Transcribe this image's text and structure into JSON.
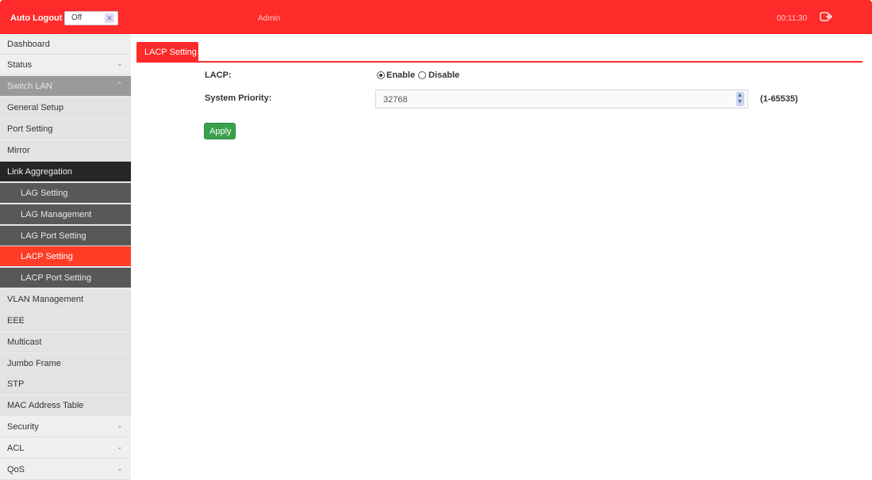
{
  "header": {
    "auto_logout_label": "Auto Logout :",
    "auto_logout_value": "Off",
    "user": "Admin",
    "time": "00:11:30",
    "logout_icon": "logout-icon"
  },
  "sidebar": {
    "items": [
      {
        "label": "Dashboard"
      },
      {
        "label": "Status"
      },
      {
        "label": "Switch LAN"
      },
      {
        "label": "General Setup"
      },
      {
        "label": "Port Setting"
      },
      {
        "label": "Mirror"
      },
      {
        "label": "Link Aggregation"
      },
      {
        "label": "LAG Setting"
      },
      {
        "label": "LAG Management"
      },
      {
        "label": "LAG Port Setting"
      },
      {
        "label": "LACP Setting"
      },
      {
        "label": "LACP Port Setting"
      },
      {
        "label": "VLAN Management"
      },
      {
        "label": "EEE"
      },
      {
        "label": "Multicast"
      },
      {
        "label": "Jumbo Frame"
      },
      {
        "label": "STP"
      },
      {
        "label": "MAC Address Table"
      },
      {
        "label": "Security"
      },
      {
        "label": "ACL"
      },
      {
        "label": "QoS"
      }
    ]
  },
  "tab": {
    "label": "LACP Setting"
  },
  "form": {
    "lacp_label": "LACP:",
    "enable_label": "Enable",
    "disable_label": "Disable",
    "selected": "Enable",
    "priority_label": "System Priority:",
    "priority_value": "32768",
    "priority_range": "(1-65535)",
    "apply_label": "Apply"
  },
  "colors": {
    "brand": "#ff2a2a",
    "active": "#ff3d26",
    "apply": "#3aa04c"
  }
}
